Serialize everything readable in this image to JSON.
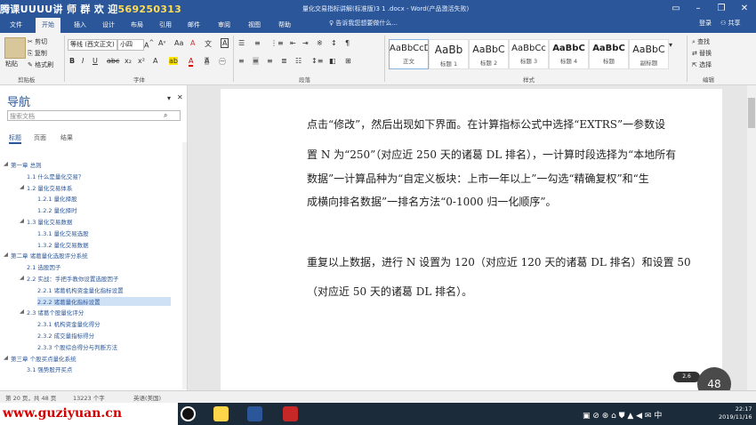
{
  "overlay_text": {
    "qq_label": "腾课UUUU讲 师 群 欢 迎",
    "qq_number": "569250313",
    "watermark": "www.guziyuan.cn"
  },
  "window": {
    "title": "量化交易指标讲解(标准版)3 1 .docx - Word(产品激活失败)",
    "login": "登录",
    "share": "共享",
    "tell_me": "告诉我您想要做什么..."
  },
  "tabs": [
    "文件",
    "开始",
    "插入",
    "设计",
    "布局",
    "引用",
    "邮件",
    "审阅",
    "视图",
    "帮助"
  ],
  "active_tab": "开始",
  "ribbon": {
    "clipboard": {
      "paste": "粘贴",
      "cut": "剪切",
      "copy": "复制",
      "format_painter": "格式刷",
      "label": "剪贴板"
    },
    "font": {
      "name": "等线 (西文正文)",
      "size": "小四",
      "label": "字体"
    },
    "paragraph": {
      "label": "段落"
    },
    "styles": {
      "label": "样式",
      "items": [
        {
          "sample": "AaBbCcD",
          "name": "正文"
        },
        {
          "sample": "AaBb",
          "name": "标题 1"
        },
        {
          "sample": "AaBbC",
          "name": "标题 2"
        },
        {
          "sample": "AaBbCc",
          "name": "标题 3"
        },
        {
          "sample": "AaBbC",
          "name": "标题 4"
        },
        {
          "sample": "AaBbC",
          "name": "标题"
        },
        {
          "sample": "AaBbC",
          "name": "副标题"
        }
      ]
    },
    "editing": {
      "find": "查找",
      "replace": "替换",
      "select": "选择",
      "label": "编辑"
    }
  },
  "nav_pane": {
    "title": "导航",
    "search_placeholder": "搜索文档",
    "tabs": [
      "标题",
      "页面",
      "结果"
    ],
    "headings": [
      {
        "text": "第一章 总则",
        "level": 1
      },
      {
        "text": "1.1 什么是量化交易？",
        "level": 2
      },
      {
        "text": "1.2 量化交易体系",
        "level": 2
      },
      {
        "text": "1.2.1 量化择股",
        "level": 3
      },
      {
        "text": "1.2.2 量化择时",
        "level": 3
      },
      {
        "text": "1.3 量化交易数据",
        "level": 2
      },
      {
        "text": "1.3.1 量化交易选股",
        "level": 3
      },
      {
        "text": "1.3.2 量化交易数据",
        "level": 3
      },
      {
        "text": "第二章 诸葛量化选股评分系统",
        "level": 1
      },
      {
        "text": "2.1 选股因子",
        "level": 2
      },
      {
        "text": "2.2 实战：手把手教你设置选股因子",
        "level": 2
      },
      {
        "text": "2.2.1 诸葛机构资金量化指标设置",
        "level": 3
      },
      {
        "text": "2.2.2 诸葛量化指标设置",
        "level": 3,
        "selected": true
      },
      {
        "text": "2.3 诸葛个股量化评分",
        "level": 2
      },
      {
        "text": "2.3.1 机构资金量化得分",
        "level": 3
      },
      {
        "text": "2.3.2 成交量指标得分",
        "level": 3
      },
      {
        "text": "2.3.3 个股综合得分与判断方法",
        "level": 3
      },
      {
        "text": "第三章 个股买点量化系统",
        "level": 1
      },
      {
        "text": "3.1 强势股开买点",
        "level": 2
      }
    ]
  },
  "document": {
    "lines": [
      "点击“修改”，然后出现如下界面。在计算指标公式中选择“EXTRS”一参数设",
      "置 N 为“250”（对应近 250 天的诸葛 DL 排名），一计算时段选择为“本地所有",
      "数据”一计算品种为“自定义板块：上市一年以上”一勾选“精确复权”和“生",
      "成横向排名数据”一排名方法“0-1000 归一化顺序”。",
      "",
      "重复以上数据，进行 N 设置为 120（对应近 120 天的诸葛 DL 排名）和设置 50",
      "（对应近 50 天的诸葛 DL 排名）。"
    ]
  },
  "status": {
    "page": "第 20 页，共 48 页",
    "words": "13223 个字",
    "lang": "英语(美国)"
  },
  "overlay": {
    "zoom_badge": "48",
    "speed": "2.6"
  },
  "taskbar": {
    "time": "22:17",
    "date": "2019/11/16"
  }
}
